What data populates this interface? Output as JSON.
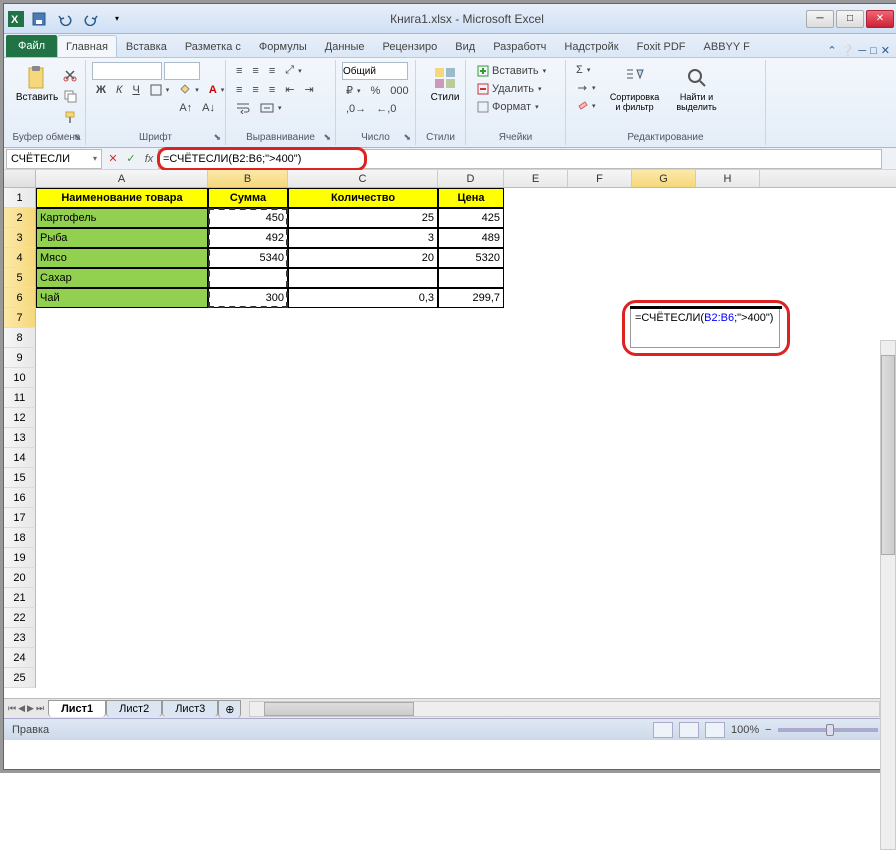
{
  "window": {
    "title": "Книга1.xlsx - Microsoft Excel"
  },
  "tabs": {
    "file": "Файл",
    "list": [
      "Главная",
      "Вставка",
      "Разметка с",
      "Формулы",
      "Данные",
      "Рецензиро",
      "Вид",
      "Разработч",
      "Надстройк",
      "Foxit PDF",
      "ABBYY F"
    ],
    "active": 0
  },
  "ribbon": {
    "clipboard": {
      "label": "Буфер обмена",
      "paste": "Вставить"
    },
    "font": {
      "label": "Шрифт",
      "family": "",
      "size": "",
      "bold": "Ж",
      "italic": "К",
      "underline": "Ч"
    },
    "alignment": {
      "label": "Выравнивание"
    },
    "number": {
      "label": "Число",
      "format": "Общий"
    },
    "styles": {
      "label": "Стили",
      "btn": "Стили"
    },
    "cells": {
      "label": "Ячейки",
      "insert": "Вставить",
      "delete": "Удалить",
      "format": "Формат"
    },
    "editing": {
      "label": "Редактирование",
      "sort": "Сортировка и фильтр",
      "find": "Найти и выделить"
    }
  },
  "formula_bar": {
    "name_box": "СЧЁТЕСЛИ",
    "formula": "=СЧЁТЕСЛИ(B2:B6;\">400\")"
  },
  "columns": [
    "A",
    "B",
    "C",
    "D",
    "E",
    "F",
    "G",
    "H"
  ],
  "table": {
    "headers": [
      "Наименование товара",
      "Сумма",
      "Количество",
      "Цена"
    ],
    "rows": [
      {
        "name": "Картофель",
        "sum": "450",
        "qty": "25",
        "price": "425"
      },
      {
        "name": "Рыба",
        "sum": "492",
        "qty": "3",
        "price": "489"
      },
      {
        "name": "Мясо",
        "sum": "5340",
        "qty": "20",
        "price": "5320"
      },
      {
        "name": "Сахар",
        "sum": "",
        "qty": "",
        "price": ""
      },
      {
        "name": "Чай",
        "sum": "300",
        "qty": "0,3",
        "price": "299,7"
      }
    ]
  },
  "overlay": {
    "pre": "=СЧЁТЕСЛИ(",
    "range": "B2:B6",
    "post": ";\">400\")"
  },
  "sheets": {
    "list": [
      "Лист1",
      "Лист2",
      "Лист3"
    ],
    "active": 0
  },
  "status": {
    "mode": "Правка",
    "zoom": "100%",
    "minus": "−",
    "plus": "+"
  }
}
